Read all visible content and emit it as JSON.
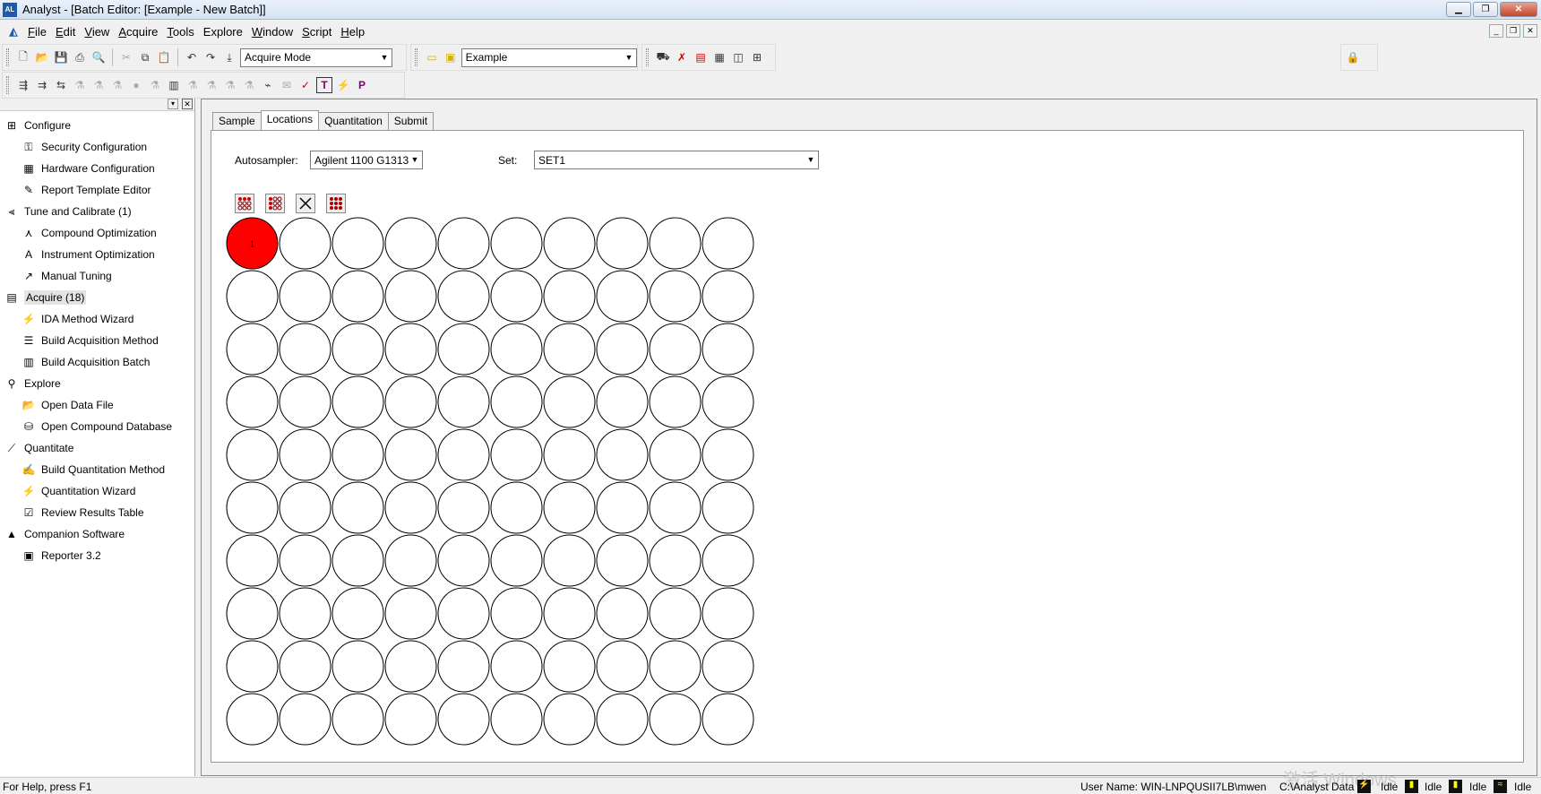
{
  "window": {
    "title": "Analyst - [Batch Editor: [Example - New Batch]]",
    "app_icon_text": "AL"
  },
  "menu": [
    {
      "label": "File",
      "u": "F",
      "rest": "ile"
    },
    {
      "label": "Edit",
      "u": "E",
      "rest": "dit"
    },
    {
      "label": "View",
      "u": "V",
      "rest": "iew"
    },
    {
      "label": "Acquire",
      "u": "A",
      "rest": "cquire"
    },
    {
      "label": "Tools",
      "u": "T",
      "rest": "ools"
    },
    {
      "label": "Explore",
      "u": "",
      "rest": "Explore"
    },
    {
      "label": "Window",
      "u": "W",
      "rest": "indow"
    },
    {
      "label": "Script",
      "u": "S",
      "rest": "cript"
    },
    {
      "label": "Help",
      "u": "H",
      "rest": "elp"
    }
  ],
  "toolbar": {
    "mode_value": "Acquire Mode",
    "project_value": "Example"
  },
  "nav": {
    "items": [
      {
        "type": "cat",
        "label": "Configure",
        "icon": "configure-icon",
        "glyph": "⊞"
      },
      {
        "type": "child",
        "label": "Security Configuration",
        "icon": "key-icon",
        "glyph": "⚿"
      },
      {
        "type": "child",
        "label": "Hardware Configuration",
        "icon": "hardware-icon",
        "glyph": "▦"
      },
      {
        "type": "child",
        "label": "Report Template Editor",
        "icon": "template-icon",
        "glyph": "✎"
      },
      {
        "type": "cat",
        "label": "Tune and Calibrate  (1)",
        "icon": "tune-icon",
        "glyph": "⫷"
      },
      {
        "type": "child",
        "label": "Compound Optimization",
        "icon": "compound-opt-icon",
        "glyph": "⋏"
      },
      {
        "type": "child",
        "label": "Instrument Optimization",
        "icon": "instrument-opt-icon",
        "glyph": "A"
      },
      {
        "type": "child",
        "label": "Manual Tuning",
        "icon": "manual-tuning-icon",
        "glyph": "↗"
      },
      {
        "type": "cat",
        "label": "Acquire  (18)",
        "icon": "acquire-icon",
        "glyph": "▤",
        "selected": true
      },
      {
        "type": "child",
        "label": "IDA Method Wizard",
        "icon": "wand-icon",
        "glyph": "⚡"
      },
      {
        "type": "child",
        "label": "Build Acquisition Method",
        "icon": "acq-method-icon",
        "glyph": "☰"
      },
      {
        "type": "child",
        "label": "Build Acquisition Batch",
        "icon": "acq-batch-icon",
        "glyph": "▥"
      },
      {
        "type": "cat",
        "label": "Explore",
        "icon": "explore-icon",
        "glyph": "⚲"
      },
      {
        "type": "child",
        "label": "Open Data File",
        "icon": "folder-icon",
        "glyph": "📂"
      },
      {
        "type": "child",
        "label": "Open Compound Database",
        "icon": "database-icon",
        "glyph": "⛁"
      },
      {
        "type": "cat",
        "label": "Quantitate",
        "icon": "quantitate-icon",
        "glyph": "⟋"
      },
      {
        "type": "child",
        "label": "Build Quantitation Method",
        "icon": "quant-method-icon",
        "glyph": "✍"
      },
      {
        "type": "child",
        "label": "Quantitation Wizard",
        "icon": "wand-icon",
        "glyph": "⚡"
      },
      {
        "type": "child",
        "label": "Review Results Table",
        "icon": "results-icon",
        "glyph": "☑"
      },
      {
        "type": "cat",
        "label": "Companion Software",
        "icon": "companion-icon",
        "glyph": "▲"
      },
      {
        "type": "child",
        "label": "Reporter 3.2",
        "icon": "reporter-icon",
        "glyph": "▣"
      }
    ]
  },
  "tabs": [
    {
      "label": "Sample",
      "active": false
    },
    {
      "label": "Locations",
      "active": true
    },
    {
      "label": "Quantitation",
      "active": false
    },
    {
      "label": "Submit",
      "active": false
    }
  ],
  "locations": {
    "autosampler_label": "Autosampler:",
    "autosampler_value": "Agilent 1100 G1313",
    "set_label": "Set:",
    "set_value": "SET1",
    "plate": {
      "rows": 10,
      "cols": 10,
      "filled": [
        {
          "index": 0,
          "label": "1"
        }
      ],
      "fill_color": "#ff0000"
    }
  },
  "status": {
    "help": "For Help, press F1",
    "user": "User Name: WIN-LNPQUSII7LB\\mwen",
    "path": "C:\\Analyst Data",
    "states": [
      "Idle",
      "Idle",
      "Idle",
      "Idle"
    ],
    "watermark": "激活 Windows"
  }
}
